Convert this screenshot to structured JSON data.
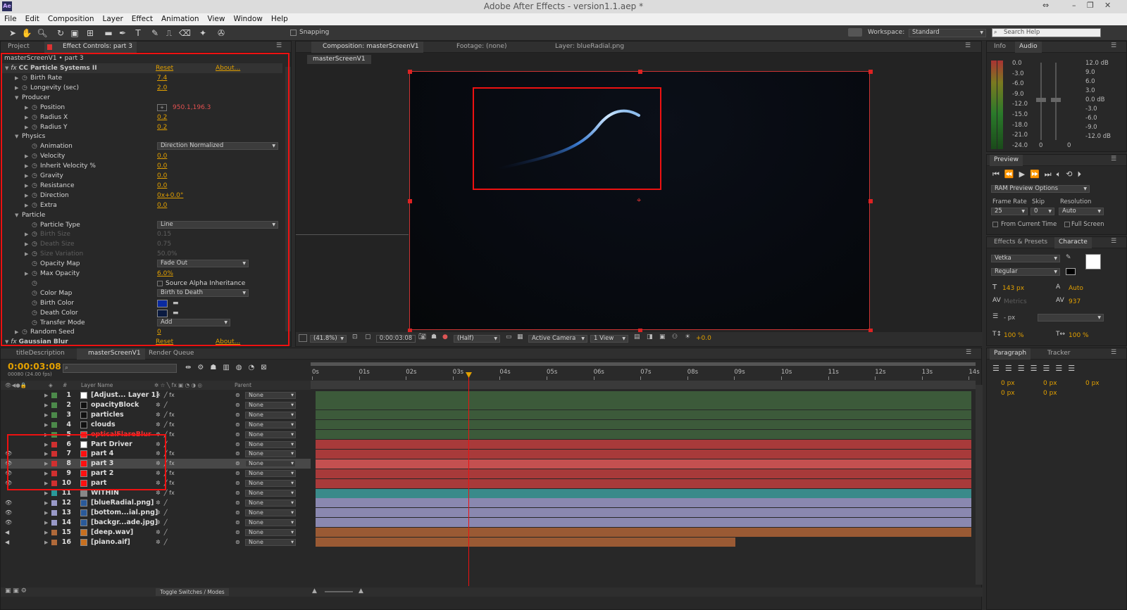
{
  "window": {
    "title": "Adobe After Effects - version1.1.aep *",
    "logo": "Ae"
  },
  "menu": [
    "File",
    "Edit",
    "Composition",
    "Layer",
    "Effect",
    "Animation",
    "View",
    "Window",
    "Help"
  ],
  "toolbar": {
    "snapping": "Snapping",
    "workspace_label": "Workspace:",
    "workspace_value": "Standard",
    "search_placeholder": "Search Help"
  },
  "effect_panel": {
    "tabs": [
      "Project",
      "Effect Controls: part 3"
    ],
    "header": "masterScreenV1 • part 3",
    "effect_name": "CC Particle Systems II",
    "reset": "Reset",
    "about": "About...",
    "props": [
      {
        "label": "Birth Rate",
        "value": "7.4"
      },
      {
        "label": "Longevity (sec)",
        "value": "2.0"
      },
      {
        "label": "Producer",
        "value": ""
      },
      {
        "label": "Position",
        "value": "950.1,196.3"
      },
      {
        "label": "Radius X",
        "value": "0.2"
      },
      {
        "label": "Radius Y",
        "value": "0.2"
      },
      {
        "label": "Physics",
        "value": ""
      },
      {
        "label": "Animation",
        "value": "Direction Normalized"
      },
      {
        "label": "Velocity",
        "value": "0.0"
      },
      {
        "label": "Inherit Velocity %",
        "value": "0.0"
      },
      {
        "label": "Gravity",
        "value": "0.0"
      },
      {
        "label": "Resistance",
        "value": "0.0"
      },
      {
        "label": "Direction",
        "value": "0x+0.0°"
      },
      {
        "label": "Extra",
        "value": "0.0"
      },
      {
        "label": "Particle",
        "value": ""
      },
      {
        "label": "Particle Type",
        "value": "Line"
      },
      {
        "label": "Birth Size",
        "value": "0.15"
      },
      {
        "label": "Death Size",
        "value": "0.75"
      },
      {
        "label": "Size Variation",
        "value": "50.0%"
      },
      {
        "label": "Opacity Map",
        "value": "Fade Out"
      },
      {
        "label": "Max Opacity",
        "value": "6.0%"
      },
      {
        "label": "",
        "value": "Source Alpha Inheritance"
      },
      {
        "label": "Color Map",
        "value": "Birth to Death"
      },
      {
        "label": "Birth Color",
        "value": ""
      },
      {
        "label": "Death Color",
        "value": ""
      },
      {
        "label": "Transfer Mode",
        "value": "Add"
      },
      {
        "label": "Random Seed",
        "value": "0"
      }
    ],
    "effect2": "Gaussian Blur",
    "effect2_reset": "Reset",
    "effect2_about": "About..."
  },
  "comp_panel": {
    "tabs": [
      "Composition: masterScreenV1",
      "Footage: (none)",
      "Layer: blueRadial.png"
    ],
    "subtab": "masterScreenV1",
    "zoom": "(41.8%)",
    "timecode": "0:00:03:08",
    "resolution": "(Half)",
    "camera": "Active Camera",
    "views": "1 View",
    "exposure": "+0.0"
  },
  "info_panel": {
    "tabs": [
      "Info",
      "Audio"
    ],
    "left_scale": [
      "0.0",
      "-3.0",
      "-6.0",
      "-9.0",
      "-12.0",
      "-15.0",
      "-18.0",
      "-21.0",
      "-24.0"
    ],
    "right_scale": [
      "12.0 dB",
      "9.0",
      "6.0",
      "3.0",
      "0.0 dB",
      "-3.0",
      "-6.0",
      "-9.0",
      "-12.0 dB"
    ],
    "zero": "0"
  },
  "preview_panel": {
    "title": "Preview",
    "ram": "RAM Preview Options",
    "frame_rate_label": "Frame Rate",
    "skip_label": "Skip",
    "resolution_label": "Resolution",
    "frame_rate": "25",
    "skip": "0",
    "resolution": "Auto",
    "from_current": "From Current Time",
    "full_screen": "Full Screen"
  },
  "char_panel": {
    "tabs": [
      "Effects & Presets",
      "Characte"
    ],
    "font": "Vetka",
    "style": "Regular",
    "size": "143 px",
    "leading": "Auto",
    "kerning": "Metrics",
    "tracking": "937",
    "stroke": "- px",
    "vscale": "100 %",
    "hscale": "100 %",
    "px": "px"
  },
  "para_panel": {
    "tabs": [
      "Paragraph",
      "Tracker"
    ],
    "vals": [
      "0 px",
      "0 px",
      "0 px",
      "0 px",
      "0 px"
    ]
  },
  "timeline": {
    "tabs": [
      "titleDescription",
      "masterScreenV1",
      "Render Queue"
    ],
    "timecode": "0:00:03:08",
    "fps": "00080 (24.00 fps)",
    "col_layer": "Layer Name",
    "col_parent": "Parent",
    "col_num": "#",
    "ruler": [
      "0s",
      "01s",
      "02s",
      "03s",
      "04s",
      "05s",
      "06s",
      "07s",
      "08s",
      "09s",
      "10s",
      "11s",
      "12s",
      "13s",
      "14s"
    ],
    "layers": [
      {
        "n": "1",
        "name": "[Adjust... Layer 1]",
        "color": "#ffffff",
        "label": "#4c8a4a",
        "bar": "#3c5a3a"
      },
      {
        "n": "2",
        "name": "opacityBlock",
        "color": "#111111",
        "label": "#4c8a4a",
        "bar": "#3c5a3a"
      },
      {
        "n": "3",
        "name": "particles",
        "color": "#111111",
        "label": "#4c8a4a",
        "bar": "#3c5a3a"
      },
      {
        "n": "4",
        "name": "clouds",
        "color": "#111111",
        "label": "#4c8a4a",
        "bar": "#3c5a3a"
      },
      {
        "n": "5",
        "name": "opticalFlareBlur",
        "color": "#ff2020",
        "label": "#4c8a4a",
        "bar": "#3c5a3a"
      },
      {
        "n": "6",
        "name": "Part Driver",
        "color": "#ffffff",
        "label": "#d03030",
        "bar": "#a83a3a"
      },
      {
        "n": "7",
        "name": "part 4",
        "color": "#ff1010",
        "label": "#d03030",
        "bar": "#a83a3a"
      },
      {
        "n": "8",
        "name": "part 3",
        "color": "#ff1010",
        "label": "#d03030",
        "bar": "#c45050"
      },
      {
        "n": "9",
        "name": "part 2",
        "color": "#ff1010",
        "label": "#d03030",
        "bar": "#a83a3a"
      },
      {
        "n": "10",
        "name": "part",
        "color": "#ff1010",
        "label": "#d03030",
        "bar": "#a83a3a"
      },
      {
        "n": "11",
        "name": "WITHIN",
        "color": "#888888",
        "label": "#2a9a9a",
        "bar": "#3a8a8a"
      },
      {
        "n": "12",
        "name": "[blueRadial.png]",
        "color": "#2a5a9a",
        "label": "#9a9ac8",
        "bar": "#8a88b0"
      },
      {
        "n": "13",
        "name": "[bottom...ial.png]",
        "color": "#2a5a9a",
        "label": "#9a9ac8",
        "bar": "#8a88b0"
      },
      {
        "n": "14",
        "name": "[backgr...ade.jpg]",
        "color": "#2a5a9a",
        "label": "#9a9ac8",
        "bar": "#8a88b0"
      },
      {
        "n": "15",
        "name": "[deep.wav]",
        "color": "#c87020",
        "label": "#b06a3a",
        "bar": "#9a5a34"
      },
      {
        "n": "16",
        "name": "[piano.aif]",
        "color": "#c87020",
        "label": "#b06a3a",
        "bar": "#9a5a34"
      }
    ],
    "parent_value": "None",
    "toggle": "Toggle Switches / Modes"
  }
}
